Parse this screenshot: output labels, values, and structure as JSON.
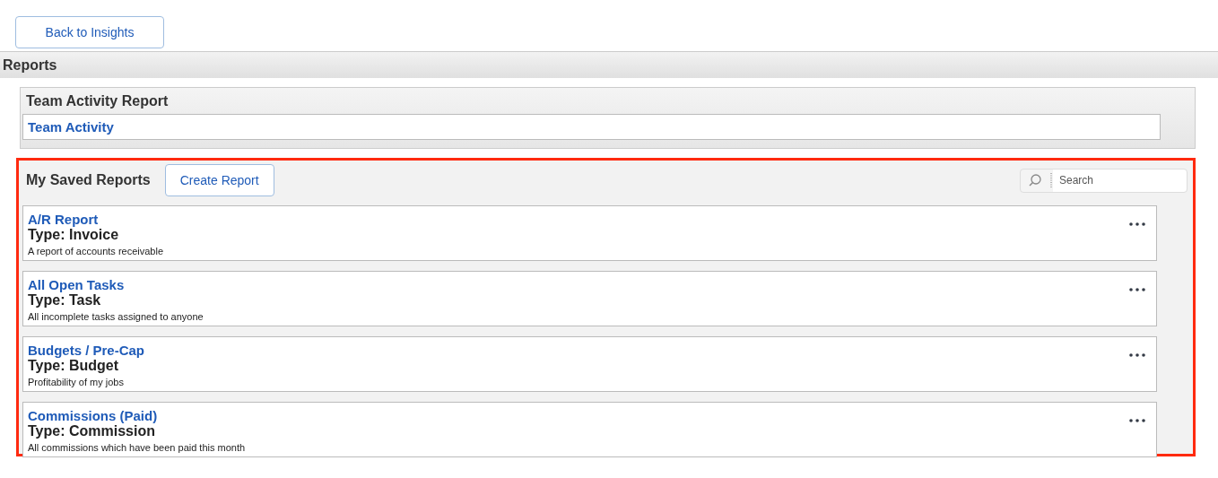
{
  "back_button": {
    "label": "Back to Insights"
  },
  "section": {
    "title": "Reports"
  },
  "team_panel": {
    "title": "Team Activity Report",
    "link": "Team Activity"
  },
  "saved_panel": {
    "title": "My Saved Reports",
    "create_button": "Create Report",
    "search": {
      "placeholder": "Search"
    },
    "highlighted": true
  },
  "reports": [
    {
      "name": "A/R Report",
      "type": "Type: Invoice",
      "description": "A report of accounts receivable"
    },
    {
      "name": "All Open Tasks",
      "type": "Type: Task",
      "description": "All incomplete tasks assigned to anyone"
    },
    {
      "name": "Budgets / Pre-Cap",
      "type": "Type: Budget",
      "description": "Profitability of my jobs"
    },
    {
      "name": "Commissions (Paid)",
      "type": "Type: Commission",
      "description": "All commissions which have been paid this month"
    }
  ]
}
